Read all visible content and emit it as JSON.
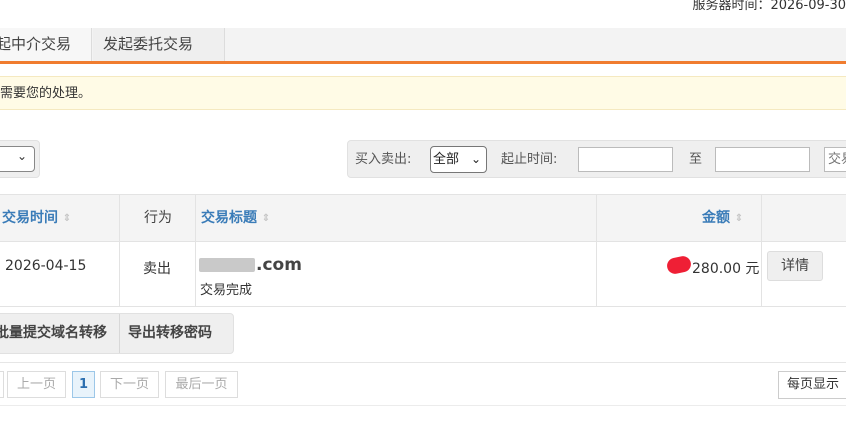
{
  "header": {
    "server_time": "服务器时间：2026-09-30"
  },
  "tabs": [
    {
      "label": "起中介交易"
    },
    {
      "label": "发起委托交易"
    }
  ],
  "notice": {
    "text": "需要您的处理。"
  },
  "filters": {
    "buy_sell_label": "买入卖出:",
    "buy_sell_value": "全部",
    "date_range_label": "起止时间:",
    "date_to_label": "至",
    "start_date_value": "",
    "end_date_value": "",
    "search_button": "交易"
  },
  "table": {
    "columns": [
      {
        "label": "交易时间"
      },
      {
        "label": "行为"
      },
      {
        "label": "交易标题"
      },
      {
        "label": "金额"
      }
    ],
    "rows": [
      {
        "time": "2026-04-15",
        "action": "卖出",
        "title": ".com",
        "status": "交易完成",
        "amount": "280.00 元",
        "detail_button": "详情"
      }
    ]
  },
  "actions": {
    "batch_transfer": "批量提交域名转移",
    "export_codes": "导出转移密码"
  },
  "pagination": {
    "prev": "上一页",
    "current": "1",
    "next": "下一页",
    "last": "最后一页",
    "per_page": "每页显示"
  },
  "icons": {
    "sort": "sort-icon",
    "dropdown": "chevron-down-icon"
  },
  "colors": {
    "accent_orange": "#f07c2f",
    "link_blue": "#3a7cb8",
    "notice_bg": "#fffbe6",
    "redaction_red": "#ef1f35"
  }
}
